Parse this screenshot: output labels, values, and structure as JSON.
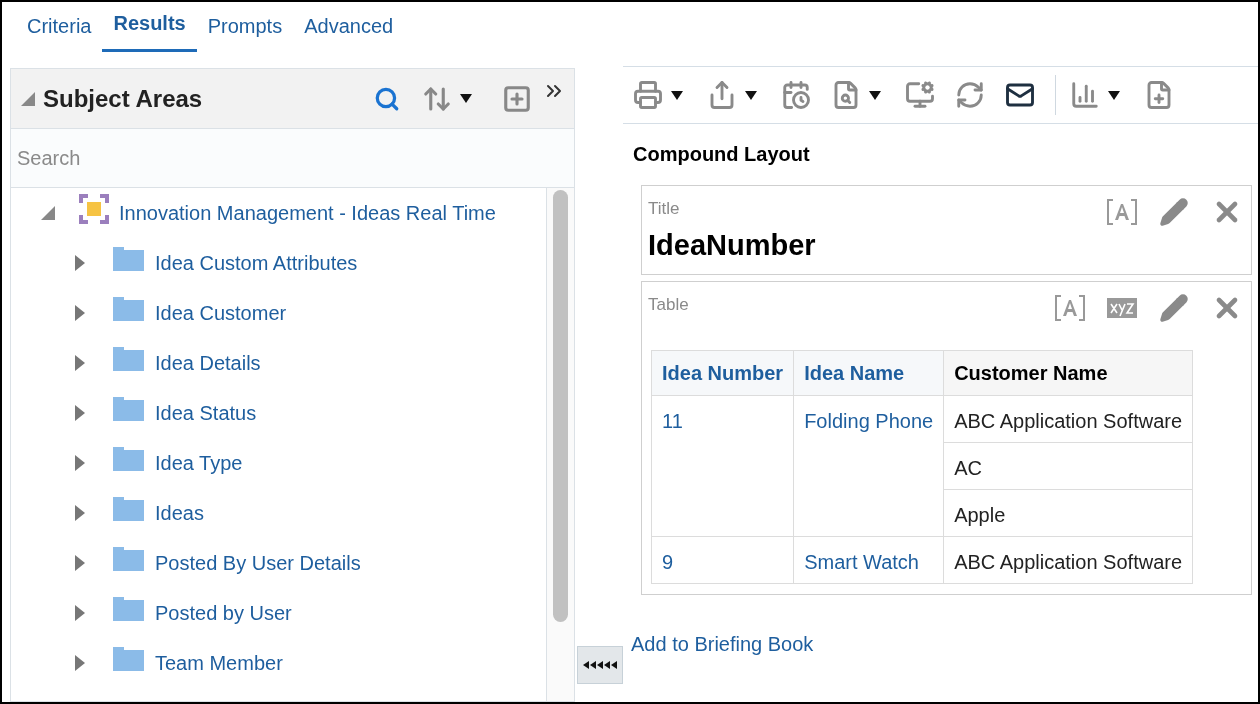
{
  "tabs": [
    {
      "label": "Criteria",
      "selected": false
    },
    {
      "label": "Results",
      "selected": true
    },
    {
      "label": "Prompts",
      "selected": false
    },
    {
      "label": "Advanced",
      "selected": false
    }
  ],
  "subject_areas": {
    "title": "Subject Areas",
    "expanded": true,
    "search": {
      "placeholder": "Search"
    },
    "tree": [
      {
        "label": "Innovation Management - Ideas Real Time",
        "kind": "subject",
        "expanded": true,
        "children": [
          {
            "label": "Idea Custom Attributes",
            "kind": "folder",
            "expanded": false
          },
          {
            "label": "Idea Customer",
            "kind": "folder",
            "expanded": false
          },
          {
            "label": "Idea Details",
            "kind": "folder",
            "expanded": false
          },
          {
            "label": "Idea Status",
            "kind": "folder",
            "expanded": false
          },
          {
            "label": "Idea Type",
            "kind": "folder",
            "expanded": false
          },
          {
            "label": "Ideas",
            "kind": "folder",
            "expanded": false
          },
          {
            "label": "Posted By User Details",
            "kind": "folder",
            "expanded": false
          },
          {
            "label": "Posted by User",
            "kind": "folder",
            "expanded": false
          },
          {
            "label": "Team Member",
            "kind": "folder",
            "expanded": false
          }
        ]
      }
    ]
  },
  "toolbar": [
    {
      "kind": "print",
      "dropdown": true
    },
    {
      "kind": "export",
      "dropdown": true
    },
    {
      "kind": "schedule",
      "dropdown": false
    },
    {
      "kind": "preview",
      "dropdown": true
    },
    {
      "kind": "properties",
      "dropdown": false
    },
    {
      "kind": "refresh",
      "dropdown": false
    },
    {
      "kind": "email",
      "dropdown": false
    },
    {
      "kind": "separator"
    },
    {
      "kind": "new_view",
      "dropdown": true
    },
    {
      "kind": "add_column",
      "dropdown": false
    }
  ],
  "layout": {
    "title": "Compound Layout",
    "title_view": {
      "label": "Title",
      "value": "IdeaNumber"
    },
    "table_view": {
      "label": "Table",
      "table": {
        "columns": [
          {
            "label": "Idea Number",
            "link": true
          },
          {
            "label": "Idea Name",
            "link": true
          },
          {
            "label": "Customer Name",
            "link": false
          }
        ],
        "groups": [
          {
            "idea_number": "11",
            "idea_name": "Folding Phone",
            "customers": [
              "ABC Application Software",
              "AC",
              "Apple"
            ]
          },
          {
            "idea_number": "9",
            "idea_name": "Smart Watch",
            "customers": [
              "ABC Application Software"
            ]
          }
        ]
      }
    }
  },
  "briefing_book_link": "Add to Briefing Book"
}
